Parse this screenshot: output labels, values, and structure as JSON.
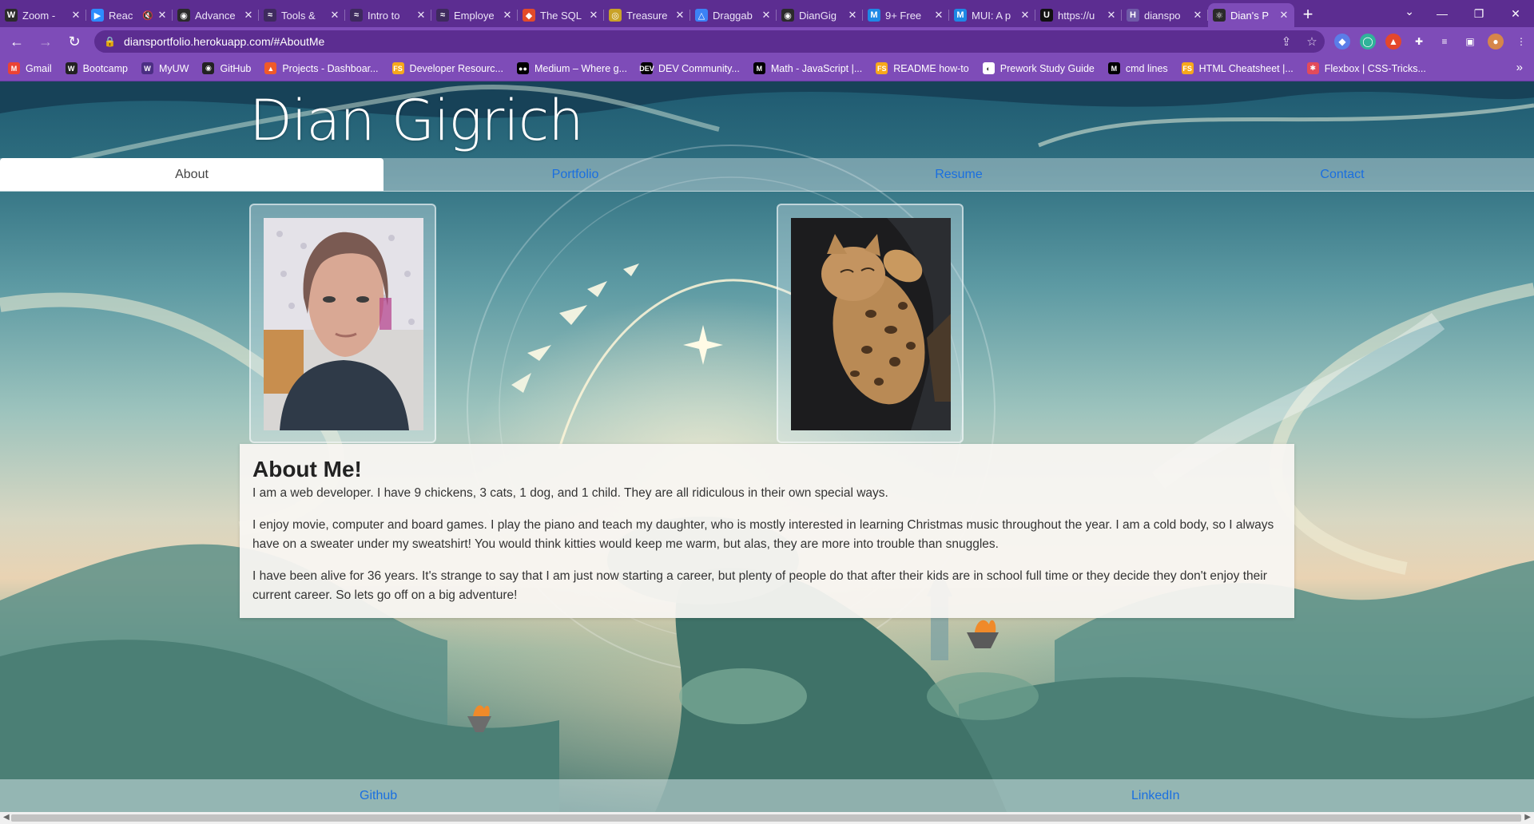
{
  "browser": {
    "tabs": [
      {
        "title": "Zoom - ",
        "favicon": "W",
        "color": "#2b2b2b"
      },
      {
        "title": "Reac",
        "favicon": "zoom-icon",
        "color": "#2d8cff",
        "muted": true
      },
      {
        "title": "Advance",
        "favicon": "github-icon",
        "color": "#2b2b2b"
      },
      {
        "title": "Tools & ",
        "favicon": "edx-icon",
        "color": "#3e2a5e"
      },
      {
        "title": "Intro to ",
        "favicon": "edx-icon",
        "color": "#3e2a5e"
      },
      {
        "title": "Employe",
        "favicon": "edx-icon",
        "color": "#3e2a5e"
      },
      {
        "title": "The SQL",
        "favicon": "diamond-icon",
        "color": "#e34b2a"
      },
      {
        "title": "Treasure",
        "favicon": "treasure-icon",
        "color": "#c9a227"
      },
      {
        "title": "Draggab",
        "favicon": "triangle-icon",
        "color": "#3b82f6"
      },
      {
        "title": "DianGig",
        "favicon": "github-icon",
        "color": "#2b2b2b"
      },
      {
        "title": "9+ Free",
        "favicon": "mui-icon",
        "color": "#1e88e5"
      },
      {
        "title": "MUI: A p",
        "favicon": "mui-icon",
        "color": "#1e88e5"
      },
      {
        "title": "https://u",
        "favicon": "U",
        "color": "#111111"
      },
      {
        "title": "dianspo",
        "favicon": "H",
        "color": "#6f5aa8"
      },
      {
        "title": "Dian's P",
        "favicon": "react-icon",
        "color": "#2a2a2a"
      }
    ],
    "new_tab": "+",
    "url": "diansportfolio.herokuapp.com/#AboutMe",
    "bookmarks": [
      {
        "label": "Gmail",
        "color": "#ea4335",
        "glyph": "M"
      },
      {
        "label": "Bootcamp",
        "color": "#222222",
        "glyph": "W"
      },
      {
        "label": "MyUW",
        "color": "#4b2e83",
        "glyph": "W"
      },
      {
        "label": "GitHub",
        "color": "#222222",
        "glyph": "◉"
      },
      {
        "label": "Projects - Dashboar...",
        "color": "#f05a28",
        "glyph": "▲"
      },
      {
        "label": "Developer Resourc...",
        "color": "#f7a81b",
        "glyph": "FS"
      },
      {
        "label": "Medium – Where g...",
        "color": "#000000",
        "glyph": "●●"
      },
      {
        "label": "DEV Community...",
        "color": "#000000",
        "glyph": "DEV"
      },
      {
        "label": "Math - JavaScript |...",
        "color": "#000000",
        "glyph": "M"
      },
      {
        "label": "README how-to",
        "color": "#f7a81b",
        "glyph": "FS"
      },
      {
        "label": "Prework Study Guide",
        "color": "#ffffff",
        "glyph": "◐"
      },
      {
        "label": "cmd lines",
        "color": "#000000",
        "glyph": "M"
      },
      {
        "label": "HTML Cheatsheet |...",
        "color": "#f7a81b",
        "glyph": "FS"
      },
      {
        "label": "Flexbox | CSS-Tricks...",
        "color": "#e34b5a",
        "glyph": "✱"
      }
    ]
  },
  "site": {
    "title": "Dian Gigrich",
    "nav": [
      "About",
      "Portfolio",
      "Resume",
      "Contact"
    ],
    "active_nav": "About",
    "about": {
      "heading": "About Me!",
      "paragraphs": [
        "I am a web developer. I have 9 chickens, 3 cats, 1 dog, and 1 child. They are all ridiculous in their own special ways.",
        "I enjoy movie, computer and board games. I play the piano and teach my daughter, who is mostly interested in learning Christmas music throughout the year. I am a cold body, so I always have on a sweater under my sweatshirt! You would think kitties would keep me warm, but alas, they are more into trouble than snuggles.",
        "I have been alive for 36 years. It's strange to say that I am just now starting a career, but plenty of people do that after their kids are in school full time or they decide they don't enjoy their current career. So lets go off on a big adventure!"
      ]
    },
    "footer": {
      "github": "Github",
      "linkedin": "LinkedIn"
    }
  },
  "colors": {
    "tabstrip": "#5c2d91",
    "toolbar": "#7e4cb8",
    "link": "#1a6fe0"
  }
}
